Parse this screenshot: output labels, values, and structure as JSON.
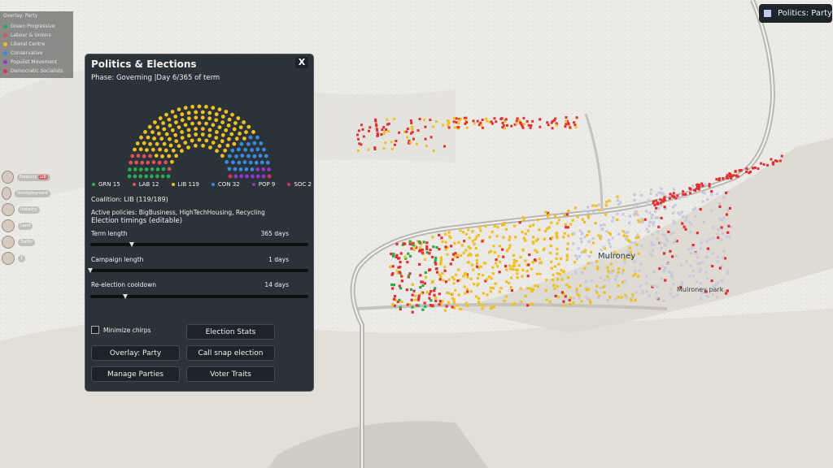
{
  "overlay_legend": {
    "title": "Overlay: Party",
    "items": [
      {
        "label": "Green Progressive",
        "color": "#2da94f"
      },
      {
        "label": "Labour & Unions",
        "color": "#e0505a"
      },
      {
        "label": "Liberal Centre",
        "color": "#f0c020"
      },
      {
        "label": "Conservative",
        "color": "#3a8be0"
      },
      {
        "label": "Populist Movement",
        "color": "#8e3ad0"
      },
      {
        "label": "Democratic Socialists",
        "color": "#e03060"
      }
    ]
  },
  "topright": {
    "label": "Politics: Party"
  },
  "left_views": [
    {
      "label": "Products",
      "badge": "LIB"
    },
    {
      "label": "Unemployment"
    },
    {
      "label": "Industry"
    },
    {
      "label": "Land"
    },
    {
      "label": "Traffic"
    },
    {
      "label": "1"
    }
  ],
  "panel": {
    "title": "Politics & Elections",
    "close": "X",
    "phase": "Phase: Governing  |Day 6/365 of term",
    "parties": [
      {
        "label": "GRN 15",
        "seats": 15,
        "color": "#2da94f"
      },
      {
        "label": "LAB 12",
        "seats": 12,
        "color": "#e0505a"
      },
      {
        "label": "LIB 119",
        "seats": 119,
        "color": "#f0c020"
      },
      {
        "label": "CON 32",
        "seats": 32,
        "color": "#3a8be0"
      },
      {
        "label": "POP 9",
        "seats": 9,
        "color": "#8e3ad0"
      },
      {
        "label": "SOC 2",
        "seats": 2,
        "color": "#e03060"
      }
    ],
    "coalition": "Coalition: LIB  (119/189)",
    "policies": "Active policies: BigBusiness, HighTechHousing, Recycling",
    "timings_title": "Election timings (editable)",
    "sliders": [
      {
        "label": "Term length",
        "value": "365 days",
        "level": 0.19
      },
      {
        "label": "Campaign length",
        "value": "1 days",
        "level": 0.0
      },
      {
        "label": "Re-election cooldown",
        "value": "14 days",
        "level": 0.16
      }
    ],
    "minimize_chirps": "Minimize chirps",
    "buttons": {
      "election_stats": "Election Stats",
      "overlay_party": "Overlay: Party",
      "snap_election": "Call snap election",
      "manage_parties": "Manage Parties",
      "voter_traits": "Voter Traits"
    }
  },
  "map": {
    "town": "Mulroney",
    "park": "Mulroney park"
  }
}
